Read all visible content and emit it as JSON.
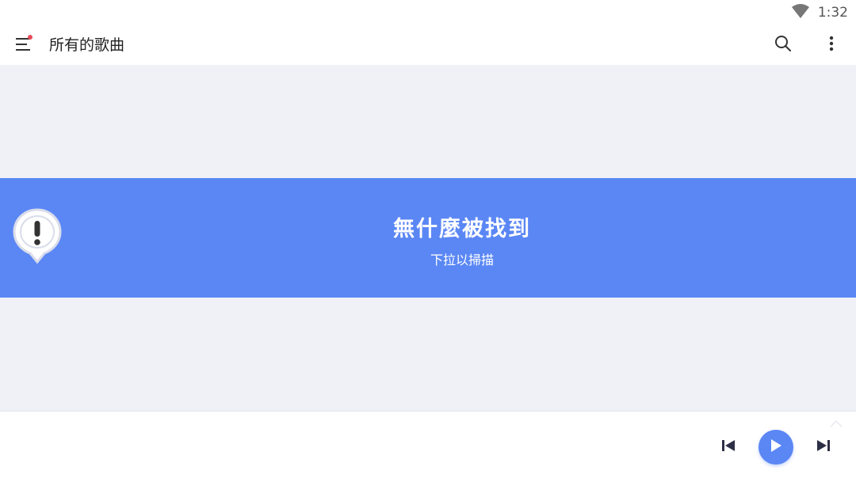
{
  "status_bar": {
    "time": "1:32",
    "icons": [
      "wifi-icon"
    ]
  },
  "app_bar": {
    "title": "所有的歌曲",
    "icons": [
      "menu-icon",
      "search-icon",
      "more-vert-icon"
    ],
    "notification_dot_color": "#e84b5a"
  },
  "empty_state": {
    "title": "無什麼被找到",
    "subtitle": "下拉以掃描",
    "icon": "alert-pin-icon",
    "background_color": "#5b87f5"
  },
  "player": {
    "controls": [
      "skip-previous-icon",
      "play-icon",
      "skip-next-icon"
    ],
    "accent_color": "#5b87f5"
  }
}
